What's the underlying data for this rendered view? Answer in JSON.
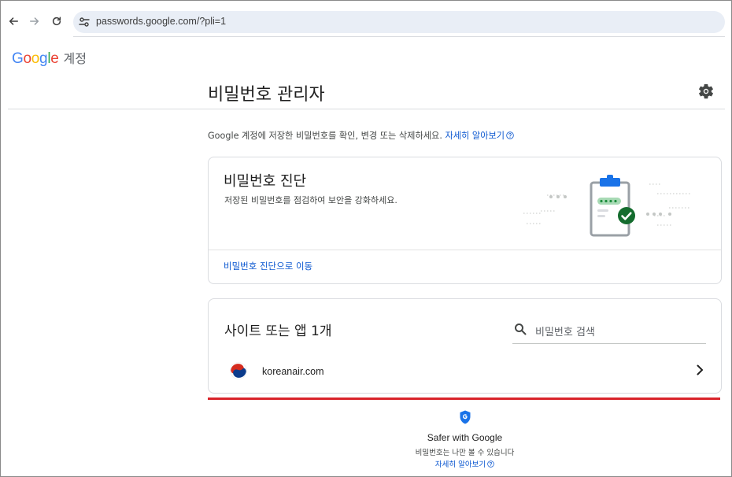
{
  "browser": {
    "url": "passwords.google.com/?pli=1"
  },
  "header": {
    "logo_letters": [
      "G",
      "o",
      "o",
      "g",
      "l",
      "e"
    ],
    "logo_colors": [
      "#4285f4",
      "#ea4335",
      "#fbbc05",
      "#4285f4",
      "#34a853",
      "#ea4335"
    ],
    "account_label": "계정"
  },
  "page": {
    "title": "비밀번호 관리자",
    "intro_text": "Google 계정에 저장한 비밀번호를 확인, 변경 또는 삭제하세요.",
    "intro_link": "자세히 알아보기"
  },
  "checkup_card": {
    "title": "비밀번호 진단",
    "subtitle": "저장된 비밀번호를 점검하여 보안을 강화하세요.",
    "cta": "비밀번호 진단으로 이동"
  },
  "sites_card": {
    "title": "사이트 또는 앱 1개",
    "search_placeholder": "비밀번호 검색",
    "items": [
      {
        "name": "koreanair.com",
        "icon": "koreanair-logo"
      }
    ]
  },
  "footer": {
    "title": "Safer with Google",
    "subtitle": "비밀번호는 나만 볼 수 있습니다",
    "link": "자세히 알아보기"
  },
  "colors": {
    "accent": "#0b57d0",
    "check_green": "#146c2e",
    "highlight_red": "#d9232a"
  }
}
